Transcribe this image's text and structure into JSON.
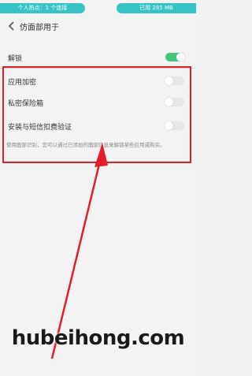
{
  "status_bar": {
    "hotspot_label": "个人热点：1 个连接",
    "data_used_label": "已用 285 MB"
  },
  "header": {
    "title": "仿面部用于"
  },
  "settings": {
    "unlock": {
      "label": "解锁",
      "enabled": true
    },
    "items": [
      {
        "label": "应用加密",
        "enabled": false
      },
      {
        "label": "私密保险箱",
        "enabled": false
      },
      {
        "label": "安装与短信扣费验证",
        "enabled": false
      }
    ],
    "note": "使用面部识别，您可以通过已添加的面部信息来解锁某些应用或购买。"
  },
  "watermark": "hubeihong.com",
  "colors": {
    "accent": "#36c3c7",
    "toggle_on": "#41c77c",
    "highlight": "#e41d2b"
  }
}
